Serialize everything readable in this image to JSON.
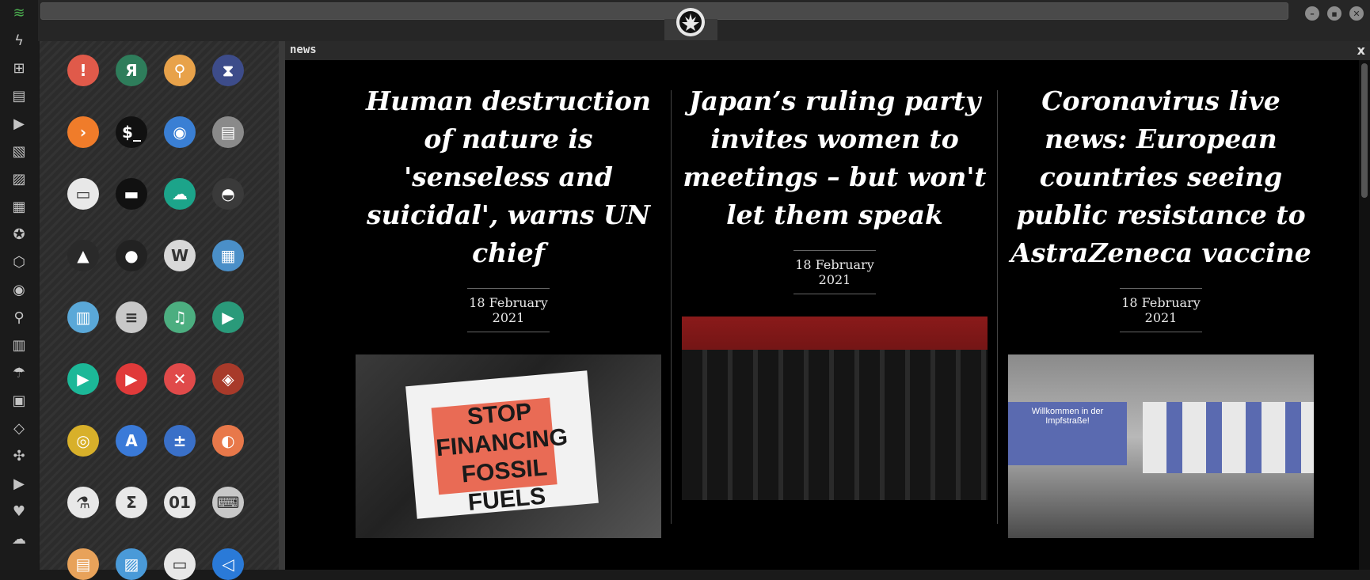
{
  "dock": {
    "icons": [
      {
        "name": "wifi-icon",
        "glyph": "≋",
        "color": "#4caf50"
      },
      {
        "name": "bolt-icon",
        "glyph": "ϟ"
      },
      {
        "name": "windows-icon",
        "glyph": "⊞"
      },
      {
        "name": "archive-icon",
        "glyph": "▤"
      },
      {
        "name": "play-circle-icon",
        "glyph": "▶"
      },
      {
        "name": "map-book-icon",
        "glyph": "▧"
      },
      {
        "name": "image-icon",
        "glyph": "▨"
      },
      {
        "name": "newspaper-icon",
        "glyph": "▦"
      },
      {
        "name": "rebel-icon",
        "glyph": "✪"
      },
      {
        "name": "hexagon-icon",
        "glyph": "⬡"
      },
      {
        "name": "globe-icon",
        "glyph": "◉"
      },
      {
        "name": "search-icon",
        "glyph": "⚲"
      },
      {
        "name": "map-icon",
        "glyph": "▥"
      },
      {
        "name": "umbrella-icon",
        "glyph": "☂"
      },
      {
        "name": "contact-icon",
        "glyph": "▣"
      },
      {
        "name": "code-icon",
        "glyph": "◇"
      },
      {
        "name": "expand-icon",
        "glyph": "✣"
      },
      {
        "name": "youtube-icon",
        "glyph": "▶"
      },
      {
        "name": "heart-icon",
        "glyph": "♥"
      },
      {
        "name": "cloud-icon",
        "glyph": "☁"
      }
    ]
  },
  "apps": [
    {
      "name": "warning-app-icon",
      "glyph": "!",
      "bg": "#e05a4a"
    },
    {
      "name": "yandex-app-icon",
      "glyph": "Я",
      "bg": "#2e7d5b"
    },
    {
      "name": "search-app-icon",
      "glyph": "⚲",
      "bg": "#e8a24a"
    },
    {
      "name": "hourglass-app-icon",
      "glyph": "⧗",
      "bg": "#3d4c8a"
    },
    {
      "name": "terminal-arrow-app-icon",
      "glyph": "›",
      "bg": "#f07c2a"
    },
    {
      "name": "terminal-app-icon",
      "glyph": "$_",
      "bg": "#111"
    },
    {
      "name": "globe-app-icon",
      "glyph": "◉",
      "bg": "#3a7fd4"
    },
    {
      "name": "server-app-icon",
      "glyph": "▤",
      "bg": "#8a8a8a"
    },
    {
      "name": "window-app-icon",
      "glyph": "▭",
      "bg": "#e8e8e8"
    },
    {
      "name": "cloud-app-icon",
      "glyph": "▬",
      "bg": "#111"
    },
    {
      "name": "cloud-lock-app-icon",
      "glyph": "☁",
      "bg": "#1ca48a"
    },
    {
      "name": "github-app-icon",
      "glyph": "◓",
      "bg": "#3a3a3a"
    },
    {
      "name": "starfleet-app-icon",
      "glyph": "▲",
      "bg": "#2a2a2a"
    },
    {
      "name": "death-star-app-icon",
      "glyph": "●",
      "bg": "#222"
    },
    {
      "name": "wikipedia-app-icon",
      "glyph": "W",
      "bg": "#d8d8d8"
    },
    {
      "name": "world-map-app-icon",
      "glyph": "▦",
      "bg": "#4a8fc8"
    },
    {
      "name": "books-app-icon",
      "glyph": "▥",
      "bg": "#5aa8d8"
    },
    {
      "name": "document-app-icon",
      "glyph": "≡",
      "bg": "#c8c8c8"
    },
    {
      "name": "music-app-icon",
      "glyph": "♫",
      "bg": "#4cae80"
    },
    {
      "name": "video-app-icon",
      "glyph": "▶",
      "bg": "#2a9a7a"
    },
    {
      "name": "media-player-app-icon",
      "glyph": "▶",
      "bg": "#1cb898"
    },
    {
      "name": "youtube-app-icon",
      "glyph": "▶",
      "bg": "#e03a3a"
    },
    {
      "name": "close-app-icon",
      "glyph": "✕",
      "bg": "#e04a4a"
    },
    {
      "name": "ironman-app-icon",
      "glyph": "◈",
      "bg": "#a83a2a"
    },
    {
      "name": "c3po-app-icon",
      "glyph": "◎",
      "bg": "#d8b02a"
    },
    {
      "name": "translate-app-icon",
      "glyph": "A",
      "bg": "#3a7ad8"
    },
    {
      "name": "calculator-app-icon",
      "glyph": "±",
      "bg": "#3a70c8"
    },
    {
      "name": "color-app-icon",
      "glyph": "◐",
      "bg": "#e8784a"
    },
    {
      "name": "flask-app-icon",
      "glyph": "⚗",
      "bg": "#e8e8e8"
    },
    {
      "name": "sigma-app-icon",
      "glyph": "Σ",
      "bg": "#e8e8e8"
    },
    {
      "name": "binary-app-icon",
      "glyph": "01",
      "bg": "#e8e8e8"
    },
    {
      "name": "keyboard-app-icon",
      "glyph": "⌨",
      "bg": "#c8c8c8"
    },
    {
      "name": "file-app-icon",
      "glyph": "▤",
      "bg": "#e8a25a"
    },
    {
      "name": "picture-app-icon",
      "glyph": "▨",
      "bg": "#4a9ad8"
    },
    {
      "name": "presentation-app-icon",
      "glyph": "▭",
      "bg": "#e8e8e8"
    },
    {
      "name": "vscode-app-icon",
      "glyph": "◁",
      "bg": "#2a7ad8"
    }
  ],
  "news": {
    "window_title": "news",
    "close_label": "x",
    "articles": [
      {
        "headline": "Human destruction of nature is 'senseless and suicidal', warns UN chief",
        "date": "18 February 2021",
        "sign_text": "STOP FINANCING FOSSIL FUELS"
      },
      {
        "headline": "Japan’s ruling party invites women to meetings – but won't let them speak",
        "date": "18 February 2021"
      },
      {
        "headline": "Coronavirus live news: European countries seeing public resistance to AstraZeneca vaccine",
        "date": "18 February 2021",
        "sign_text": "Willkommen in der Impfstraße!"
      }
    ]
  }
}
